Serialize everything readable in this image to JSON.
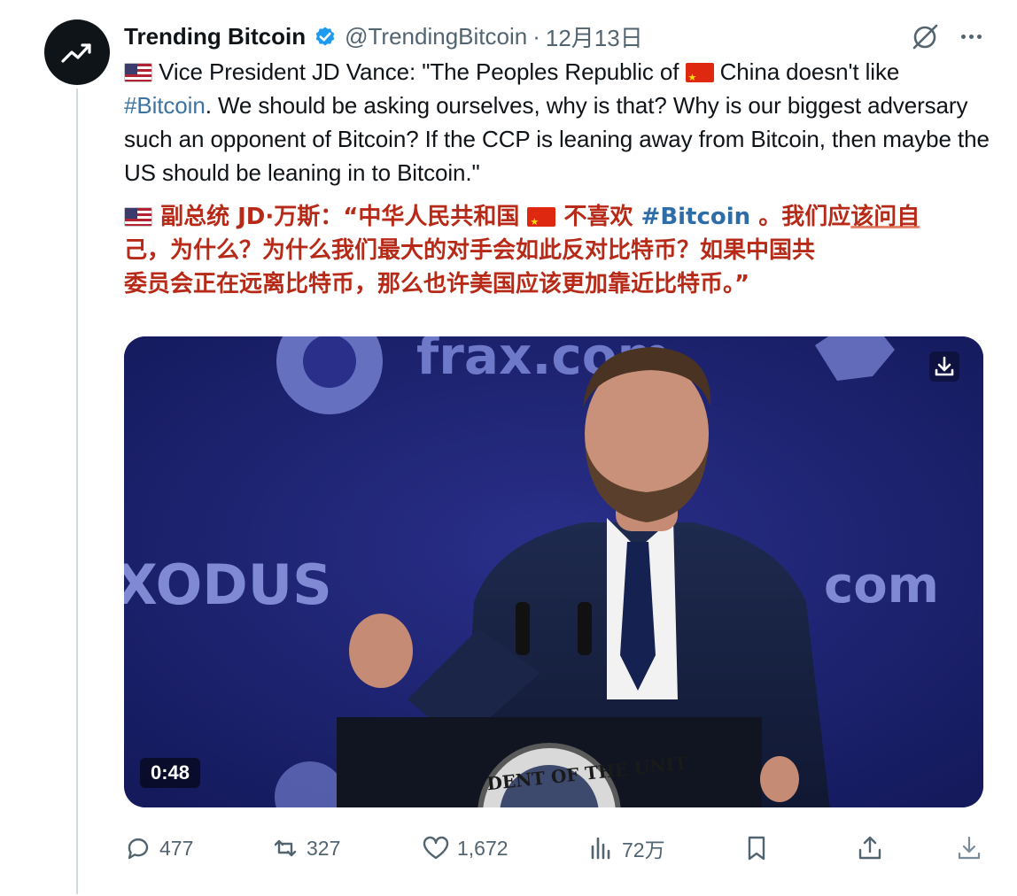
{
  "author": {
    "name": "Trending Bitcoin",
    "handle": "@TrendingBitcoin",
    "separator": "·",
    "date": "12月13日"
  },
  "tweet": {
    "line_en_1a": "Vice President JD Vance: \"The Peoples Republic of",
    "line_en_1b": "China doesn't like",
    "hashtag_en": "#Bitcoin",
    "line_en_2": ". We should be asking ourselves, why is that? Why is our biggest adversary such an opponent of Bitcoin? If the CCP is leaning away from Bitcoin, then maybe the US should be leaning in to Bitcoin.\"",
    "cn_1a": "副总统 JD·万斯：“中华人民共和国",
    "cn_1b": "不喜欢",
    "hashtag_cn": "#Bitcoin",
    "cn_1c": "。我们应",
    "cn_underlined": "该问自",
    "cn_2": "己，为什么？为什么我们最大的对手会如此反对比特币？如果中国共",
    "cn_3": "委员会正在远离比特币，那么也许美国应该更加靠近比特币。”"
  },
  "video": {
    "duration": "0:48",
    "backdrop_text_1": "frax.com",
    "backdrop_text_2": "XODUS",
    "backdrop_text_3": "com",
    "seal_text": "DENT OF THE UNIT"
  },
  "actions": {
    "replies": "477",
    "reposts": "327",
    "likes": "1,672",
    "views": "72万"
  },
  "colors": {
    "accent": "#1d9bf0",
    "chinese_text": "#b72a18",
    "muted": "#536471"
  }
}
